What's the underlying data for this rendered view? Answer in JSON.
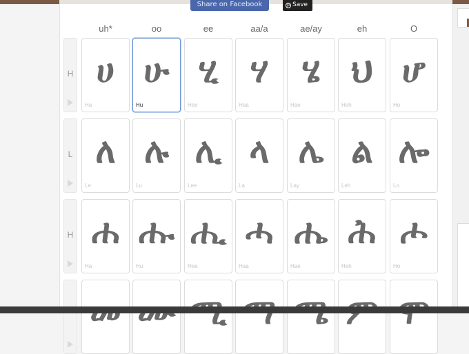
{
  "buttons": {
    "facebook_label": "Share on Facebook",
    "save_label": "Save"
  },
  "columns": [
    "uh*",
    "oo",
    "ee",
    "aa/a",
    "ae/ay",
    "eh",
    "O"
  ],
  "rows": [
    {
      "label": "H",
      "cells": [
        {
          "glyph": "ሀ",
          "roman": "Ha"
        },
        {
          "glyph": "ሁ",
          "roman": "Hu"
        },
        {
          "glyph": "ሂ",
          "roman": "Hee"
        },
        {
          "glyph": "ሃ",
          "roman": "Haa"
        },
        {
          "glyph": "ሄ",
          "roman": "Hae"
        },
        {
          "glyph": "ህ",
          "roman": "Heh"
        },
        {
          "glyph": "ሆ",
          "roman": "Ho"
        }
      ]
    },
    {
      "label": "L",
      "cells": [
        {
          "glyph": "ለ",
          "roman": "Le"
        },
        {
          "glyph": "ሉ",
          "roman": "Lu"
        },
        {
          "glyph": "ሊ",
          "roman": "Lee"
        },
        {
          "glyph": "ላ",
          "roman": "La"
        },
        {
          "glyph": "ሌ",
          "roman": "Lay"
        },
        {
          "glyph": "ል",
          "roman": "Leh"
        },
        {
          "glyph": "ሎ",
          "roman": "Lo"
        }
      ]
    },
    {
      "label": "H",
      "cells": [
        {
          "glyph": "ሐ",
          "roman": "Ha"
        },
        {
          "glyph": "ሑ",
          "roman": "Hu"
        },
        {
          "glyph": "ሒ",
          "roman": "Hee"
        },
        {
          "glyph": "ሓ",
          "roman": "Haa"
        },
        {
          "glyph": "ሔ",
          "roman": "Hae"
        },
        {
          "glyph": "ሕ",
          "roman": "Heh"
        },
        {
          "glyph": "ሖ",
          "roman": "Ho"
        }
      ]
    },
    {
      "label": "",
      "cells": [
        {
          "glyph": "መ",
          "roman": ""
        },
        {
          "glyph": "ሙ",
          "roman": ""
        },
        {
          "glyph": "ሚ",
          "roman": ""
        },
        {
          "glyph": "ማ",
          "roman": ""
        },
        {
          "glyph": "ሜ",
          "roman": ""
        },
        {
          "glyph": "ም",
          "roman": ""
        },
        {
          "glyph": "ሞ",
          "roman": ""
        }
      ]
    }
  ],
  "selected": {
    "row": 0,
    "col": 1
  },
  "icons": {
    "play": "play-icon",
    "pin": "pinterest-icon"
  },
  "colors": {
    "facebook": "#4a67ac",
    "selected_border": "#6f97d6",
    "glyph": "#6a6a6a"
  }
}
